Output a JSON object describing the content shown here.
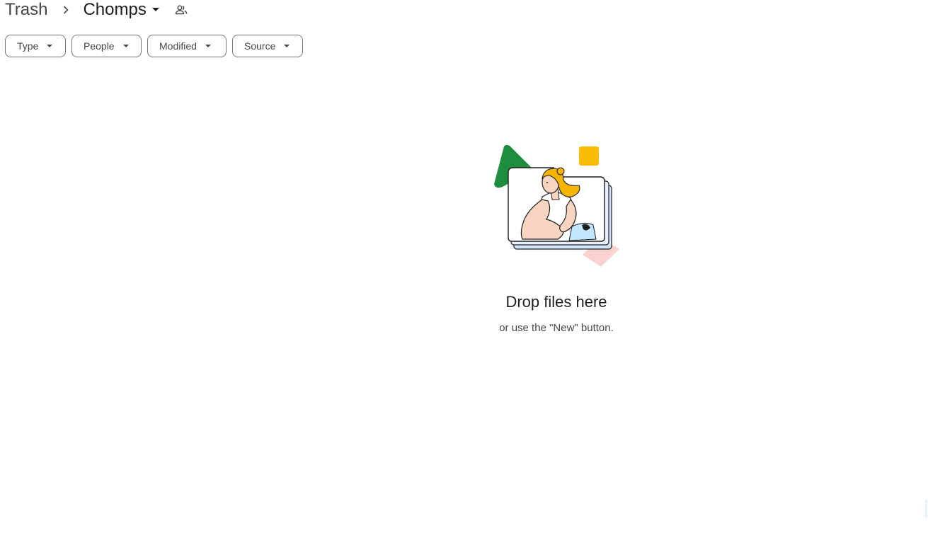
{
  "breadcrumb": {
    "root": "Trash",
    "current": "Chomps"
  },
  "filters": [
    {
      "label": "Type"
    },
    {
      "label": "People"
    },
    {
      "label": "Modified"
    },
    {
      "label": "Source"
    }
  ],
  "empty_state": {
    "title": "Drop files here",
    "subtitle": "or use the \"New\" button."
  },
  "icons": {
    "separator": "chevron-right-icon",
    "folder_menu": "caret-down-icon",
    "shared": "shared-people-icon",
    "chip_caret": "caret-down-icon"
  },
  "colors": {
    "green": "#1e8e3e",
    "yellow": "#fbbc04",
    "pink": "#fad2cf",
    "blue_light": "#d3e3fd",
    "skin": "#f8d5c0",
    "hair": "#f4b400"
  }
}
